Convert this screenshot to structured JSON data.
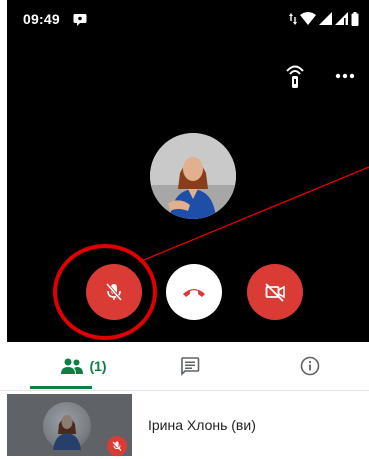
{
  "status_bar": {
    "time": "09:49"
  },
  "call": {
    "participant_avatar": "woman-in-blue-portrait",
    "controls": {
      "mute": "mic-off-icon",
      "hangup": "phone-hangup-icon",
      "camera": "videocam-off-icon"
    }
  },
  "tabs": {
    "people_count": "(1)"
  },
  "participants": [
    {
      "name": "Ірина Хлонь (ви)"
    }
  ],
  "colors": {
    "call_bg": "#000000",
    "control_red": "#db3b35",
    "tab_green": "#0b8043",
    "annotation_red": "#e00000"
  }
}
